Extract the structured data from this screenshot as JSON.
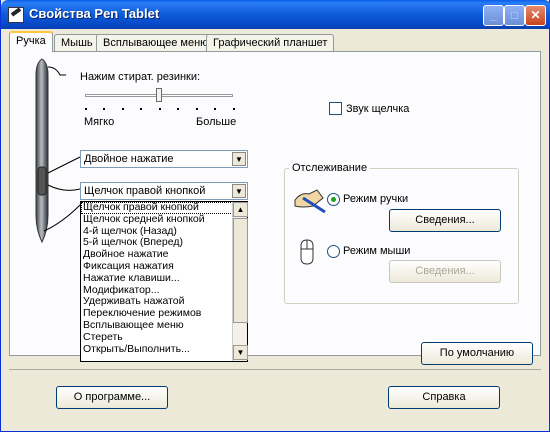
{
  "window": {
    "title": "Свойства Pen Tablet"
  },
  "tabs": [
    {
      "label": "Ручка"
    },
    {
      "label": "Мышь"
    },
    {
      "label": "Всплывающее меню"
    },
    {
      "label": "Графический планшет"
    }
  ],
  "pressure": {
    "label": "Нажим стират. резинки:",
    "min_label": "Мягко",
    "max_label": "Больше",
    "level_fraction": 0.5
  },
  "dropdown_upper": {
    "value": "Двойное нажатие"
  },
  "dropdown_lower": {
    "value": "Щелчок правой кнопкой",
    "options": [
      "Щелчок правой кнопкой",
      "Щелчок средней кнопкой",
      "4-й щелчок (Назад)",
      "5-й щелчок (Вперед)",
      "Двойное нажатие",
      "Фиксация нажатия",
      "Нажатие клавиши...",
      "Модификатор...",
      "Удерживать нажатой",
      "Переключение режимов",
      "Всплывающее меню",
      "Стереть",
      "Открыть/Выполнить..."
    ]
  },
  "click_sound": {
    "label": "Звук щелчка",
    "checked": false
  },
  "tracking": {
    "title": "Отслеживание",
    "pen_mode": {
      "label": "Режим ручки",
      "selected": true,
      "details_label": "Сведения..."
    },
    "mouse_mode": {
      "label": "Режим мыши",
      "selected": false,
      "details_label": "Сведения..."
    }
  },
  "default_button": {
    "label": "По умолчанию"
  },
  "footer": {
    "about_label": "О программе...",
    "help_label": "Справка"
  }
}
